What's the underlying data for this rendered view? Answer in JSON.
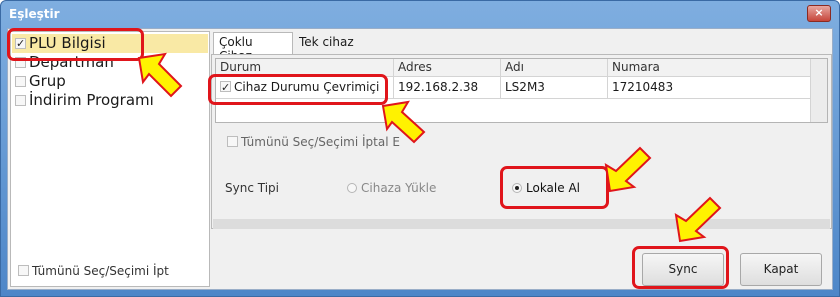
{
  "window": {
    "title": "Eşleştir",
    "close_glyph": "×"
  },
  "left_panel": {
    "items": [
      {
        "label": "PLU Bilgisi",
        "checked": true,
        "selected": true
      },
      {
        "label": "Departman",
        "checked": false,
        "selected": false
      },
      {
        "label": "Grup",
        "checked": false,
        "selected": false
      },
      {
        "label": "İndirim Programı",
        "checked": false,
        "selected": false
      }
    ],
    "select_all_label": "Tümünü Seç/Seçimi İpt"
  },
  "tabs": [
    {
      "label": "Çoklu Cihaz",
      "active": true
    },
    {
      "label": "Tek cihaz",
      "active": false
    }
  ],
  "grid": {
    "columns": [
      "Durum",
      "Adres",
      "Adı",
      "Numara"
    ],
    "rows": [
      {
        "durum": "Cihaz Durumu Çevrimiçi",
        "checked": true,
        "adres": "192.168.2.38",
        "adi": "LS2M3",
        "numara": "17210483"
      }
    ]
  },
  "right_select_all_label": "Tümünü Seç/Seçimi İptal E",
  "sync": {
    "label": "Sync Tipi",
    "options": [
      {
        "label": "Cihaza Yükle",
        "selected": false
      },
      {
        "label": "Lokale Al",
        "selected": true
      }
    ]
  },
  "buttons": {
    "sync": "Sync",
    "close": "Kapat"
  },
  "colors": {
    "highlight": "#e0151b",
    "arrow_fill": "#fff200",
    "selection": "#f9e9a5"
  }
}
